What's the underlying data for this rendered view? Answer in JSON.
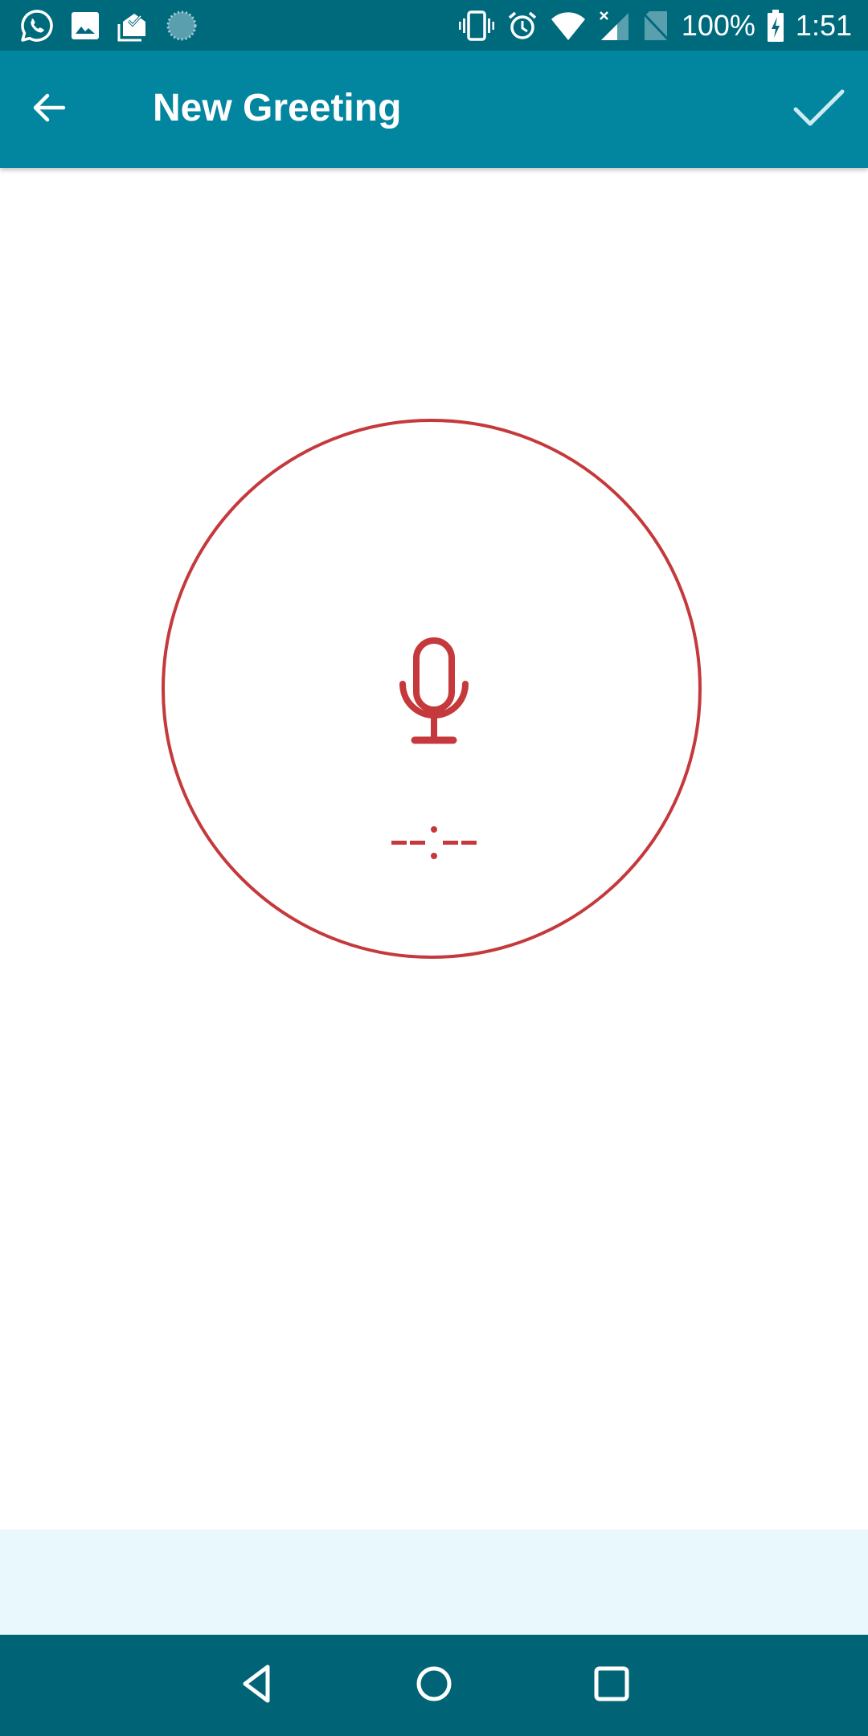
{
  "status_bar": {
    "notification_icons": [
      "whatsapp-icon",
      "image-icon",
      "mail-check-icon",
      "sync-progress-icon"
    ],
    "system_icons": [
      "vibrate-icon",
      "alarm-icon",
      "wifi-icon",
      "cell-signal-no-data-icon",
      "no-sim-icon"
    ],
    "battery_percent": "100%",
    "battery_state": "charging",
    "time": "1:51"
  },
  "app_bar": {
    "back_icon": "arrow-left-icon",
    "title": "New Greeting",
    "confirm_icon": "check-icon"
  },
  "recorder": {
    "mic_icon": "microphone-icon",
    "timer_text": "--:--",
    "accent_color": "#c5393c"
  },
  "nav_bar": {
    "buttons": [
      "back",
      "home",
      "recents"
    ]
  },
  "colors": {
    "status_bar": "#006a7d",
    "app_bar": "#0286a0",
    "bottom_panel": "#e9f8fd",
    "nav_bar": "#006476"
  }
}
